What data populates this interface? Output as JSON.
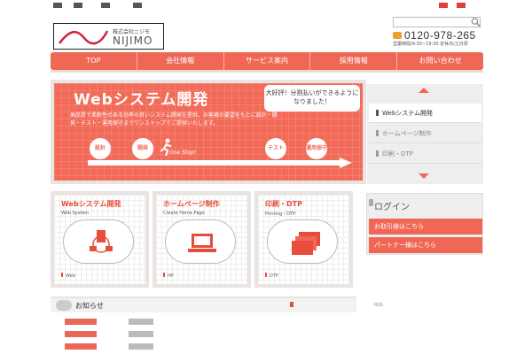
{
  "logo": {
    "company_small": "株式会社ニジモ",
    "company_big": "NIJIMO"
  },
  "header": {
    "search_placeholder": "",
    "phone_number": "0120-978-265",
    "hours": "営業時間/9:30~19:30 定休日/土日祝"
  },
  "nav": {
    "items": [
      "TOP",
      "会社情報",
      "サービス案内",
      "採用情報",
      "お問い合わせ"
    ]
  },
  "hero": {
    "title": "Webシステム開発",
    "body": "高品質で柔軟性のある効率の良いシステム開発を提供。お客様の要望をもとに設計・開発・テスト・運用保守までワンストップでご提供いたします。",
    "bubble": "大好評！分割払いができるようになりました！",
    "steps": [
      "設計",
      "開発",
      "テスト",
      "運用保守"
    ],
    "one_stop": "One Stop!"
  },
  "side_menu": {
    "items": [
      "Webシステム開発",
      "ホームページ制作",
      "印刷・DTP"
    ]
  },
  "services": [
    {
      "title": "Webシステム開発",
      "subtitle": "Web System",
      "tag": "Web"
    },
    {
      "title": "ホームページ制作",
      "subtitle": "Create Home Page",
      "tag": "HP"
    },
    {
      "title": "印刷・DTP",
      "subtitle": "Printing・DTP",
      "tag": "DTP"
    }
  ],
  "login": {
    "heading": "ログイン",
    "client_button": "お取引様はこちら",
    "partner_button": "パートナー様はこちら"
  },
  "news": {
    "title": "お知らせ",
    "rss": "RSS"
  },
  "colors": {
    "accent": "#f06855",
    "accent_dark": "#e84c3a",
    "panel": "#eeeeee"
  }
}
